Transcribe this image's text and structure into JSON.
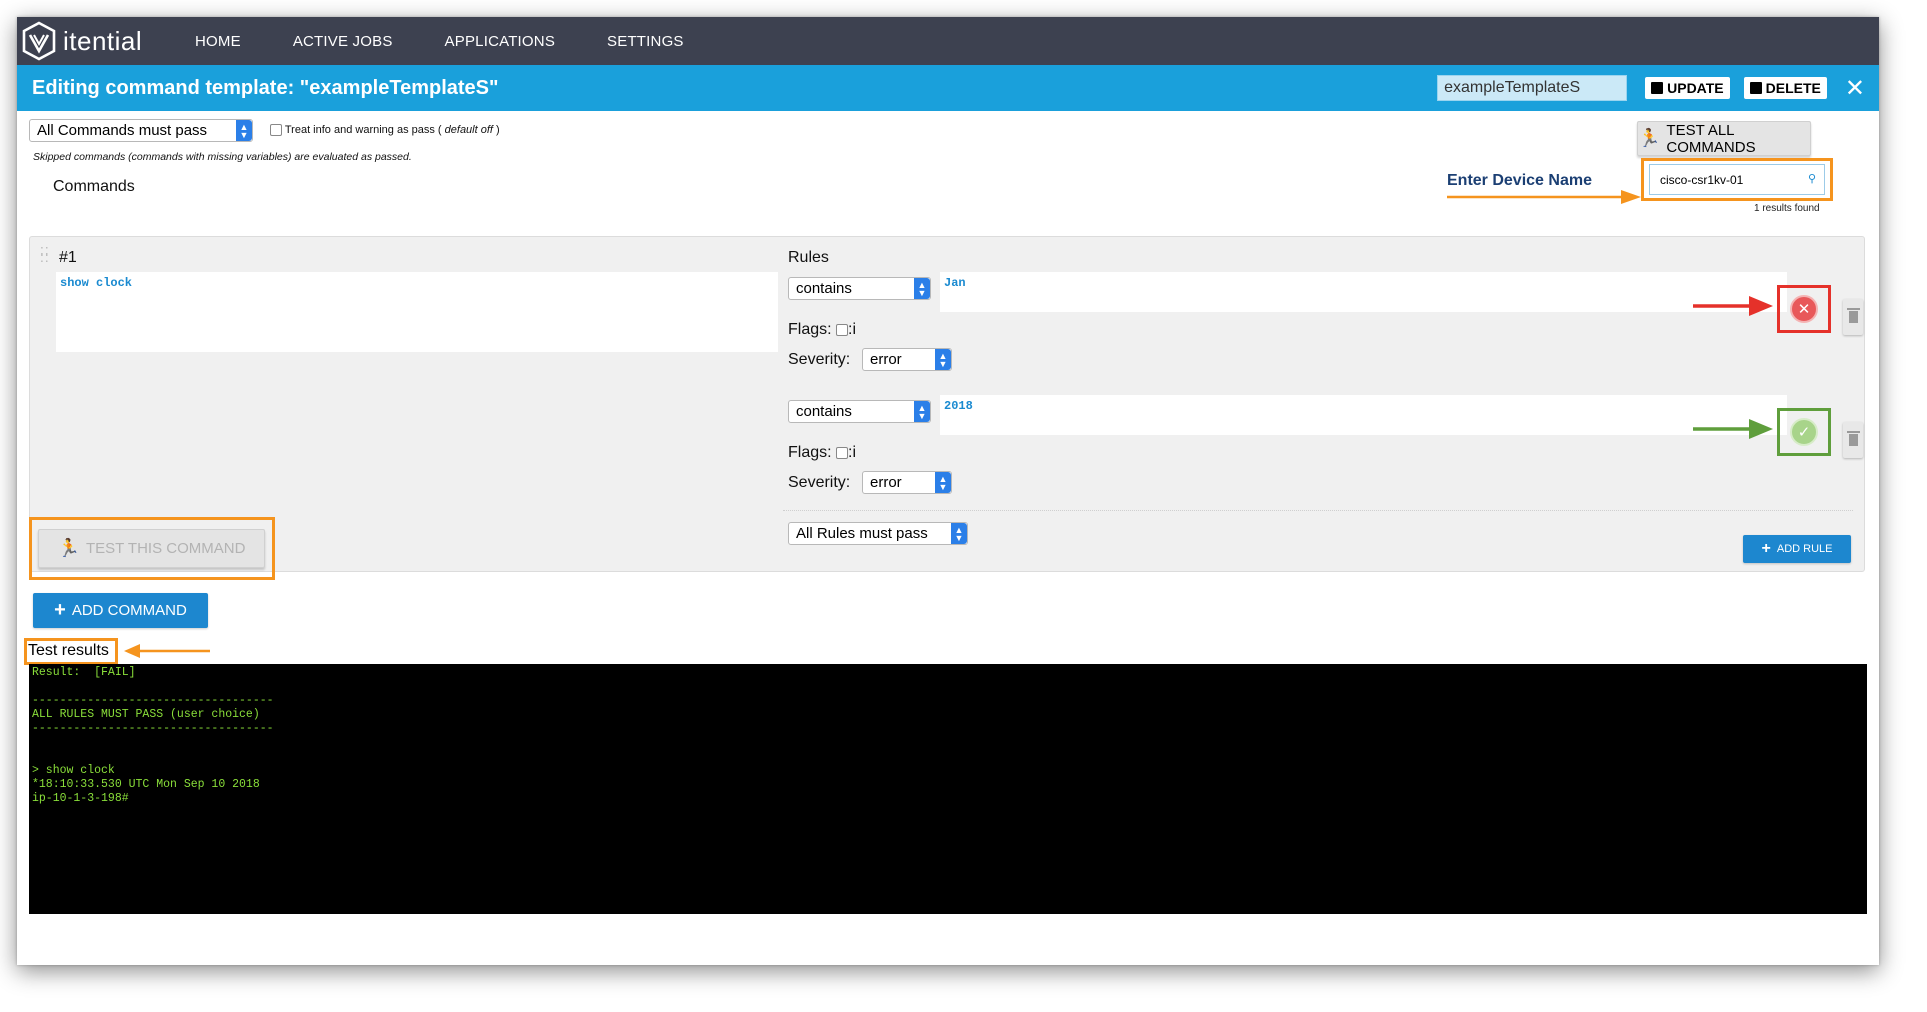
{
  "nav": {
    "logo_text": "itential",
    "items": [
      "HOME",
      "ACTIVE JOBS",
      "APPLICATIONS",
      "SETTINGS"
    ]
  },
  "titlebar": {
    "title": "Editing command template: \"exampleTemplateS\"",
    "name_value": "exampleTemplateS",
    "update_label": "UPDATE",
    "delete_label": "DELETE",
    "close_symbol": "✕"
  },
  "options": {
    "pass_mode": "All Commands must pass",
    "treat_label_prefix": "Treat info and warning as pass (",
    "treat_label_default": " default off ",
    "treat_label_suffix": ")",
    "skipped_note": "Skipped commands (commands with missing variables) are evaluated as passed.",
    "commands_heading": "Commands"
  },
  "device": {
    "test_all_label": "TEST ALL COMMANDS",
    "annotation": "Enter Device Name",
    "value": "cisco-csr1kv-01",
    "results_found": "1 results found"
  },
  "command": {
    "number": "#1",
    "text": "show clock",
    "rules_heading": "Rules",
    "rules": [
      {
        "operator": "contains",
        "value": "Jan",
        "flags_label": "Flags:",
        "flag_i": ":i",
        "severity_label": "Severity:",
        "severity": "error",
        "result": "fail"
      },
      {
        "operator": "contains",
        "value": "2018",
        "flags_label": "Flags:",
        "flag_i": ":i",
        "severity_label": "Severity:",
        "severity": "error",
        "result": "pass"
      }
    ],
    "rules_mode": "All Rules must pass",
    "add_rule_label": "ADD RULE",
    "test_command_label": "TEST THIS COMMAND"
  },
  "add_command_label": "ADD COMMAND",
  "results": {
    "heading": "Test results",
    "output": "Result:  [FAIL]\n\n-----------------------------------\nALL RULES MUST PASS (user choice)\n-----------------------------------\n\n\n> show clock\n*18:10:33.530 UTC Mon Sep 10 2018\nip-10-1-3-198#"
  },
  "colors": {
    "nav_bg": "#3d4150",
    "titlebar_bg": "#1aa0db",
    "accent_blue": "#1d87cf",
    "annotation_orange": "#f5941e",
    "fail_red": "#e5312a",
    "pass_green": "#5f9e3c",
    "terminal_text": "#8adf3a"
  }
}
